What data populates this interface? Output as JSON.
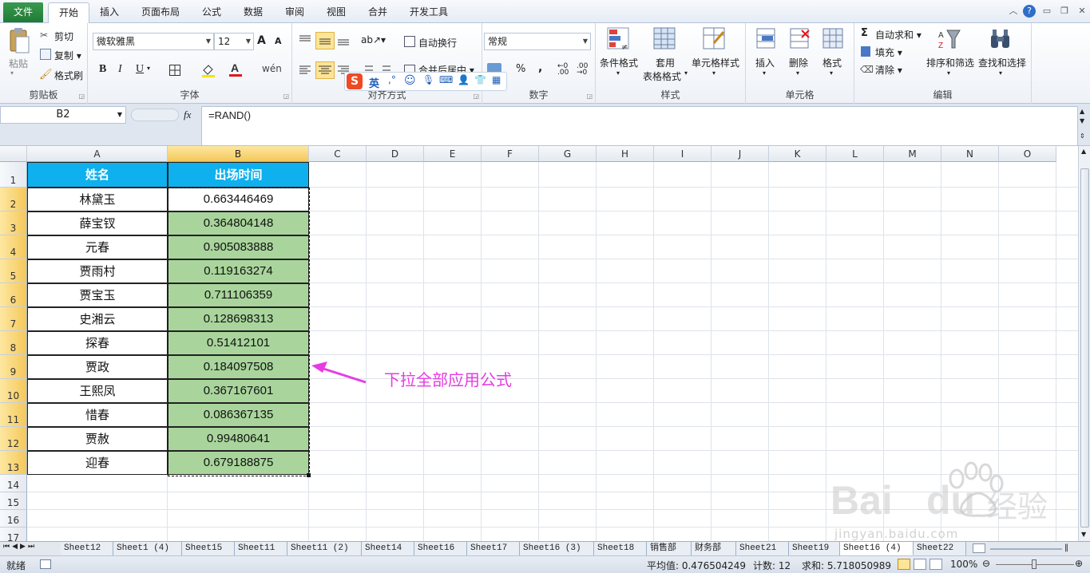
{
  "tabs": {
    "file": "文件",
    "items": [
      "开始",
      "插入",
      "页面布局",
      "公式",
      "数据",
      "审阅",
      "视图",
      "合并",
      "开发工具"
    ],
    "active_index": 0
  },
  "ribbon": {
    "clipboard": {
      "paste": "粘贴",
      "cut": "剪切",
      "copy": "复制 ▾",
      "format_painter": "格式刷",
      "label": "剪贴板"
    },
    "font": {
      "name": "微软雅黑",
      "size": "12",
      "grow": "A",
      "shrink": "A",
      "bold": "B",
      "italic": "I",
      "underline": "U",
      "label": "字体"
    },
    "alignment": {
      "wrap": "自动换行",
      "merge": "合并后居中 ▾",
      "label": "对齐方式"
    },
    "number": {
      "format": "常规",
      "percent": "%",
      "comma": ",",
      "label": "数字"
    },
    "styles": {
      "conditional": "条件格式",
      "table_format_1": "套用",
      "table_format_2": "表格格式",
      "cell_styles": "单元格样式",
      "label": "样式"
    },
    "cells": {
      "insert": "插入",
      "delete": "删除",
      "format": "格式",
      "label": "单元格"
    },
    "editing": {
      "autosum": "自动求和 ▾",
      "fill": "填充 ▾",
      "clear": "清除 ▾",
      "sort_filter": "排序和筛选",
      "find_select": "查找和选择",
      "label": "编辑"
    }
  },
  "ime": {
    "lang": "英"
  },
  "formula_bar": {
    "name_box": "B2",
    "fx": "fx",
    "formula": "=RAND()"
  },
  "columns": [
    "A",
    "B",
    "C",
    "D",
    "E",
    "F",
    "G",
    "H",
    "I",
    "J",
    "K",
    "L",
    "M",
    "N",
    "O"
  ],
  "rows": [
    "1",
    "2",
    "3",
    "4",
    "5",
    "6",
    "7",
    "8",
    "9",
    "10",
    "11",
    "12",
    "13",
    "14",
    "15",
    "16",
    "17"
  ],
  "table": {
    "headers": [
      "姓名",
      "出场时间"
    ],
    "names": [
      "林黛玉",
      "薛宝钗",
      "元春",
      "贾雨村",
      "贾宝玉",
      "史湘云",
      "探春",
      "贾政",
      "王熙凤",
      "惜春",
      "贾赦",
      "迎春"
    ],
    "values": [
      "0.663446469",
      "0.364804148",
      "0.905083888",
      "0.119163274",
      "0.711106359",
      "0.128698313",
      "0.51412101",
      "0.184097508",
      "0.367167601",
      "0.086367135",
      "0.99480641",
      "0.679188875"
    ]
  },
  "annotation": "下拉全部应用公式",
  "watermark": {
    "brand": "Bai",
    "brand2": "du",
    "product": "经验",
    "url": "jingyan.baidu.com"
  },
  "sheets": [
    "Sheet12",
    "Sheet1 (4)",
    "Sheet15",
    "Sheet11",
    "Sheet11 (2)",
    "Sheet14",
    "Sheet16",
    "Sheet17",
    "Sheet16 (3)",
    "Sheet18",
    "销售部",
    "财务部",
    "Sheet21",
    "Sheet19",
    "Sheet16 (4)",
    "Sheet22"
  ],
  "active_sheet_index": 14,
  "status": {
    "ready": "就绪",
    "average": "平均值: 0.476504249",
    "count": "计数: 12",
    "sum": "求和: 5.718050989",
    "zoom": "100%"
  },
  "colors": {
    "header_fill": "#0fb0ee",
    "value_fill": "#a9d59c",
    "annotation": "#e73ce3",
    "selection": "#f5c85a"
  }
}
